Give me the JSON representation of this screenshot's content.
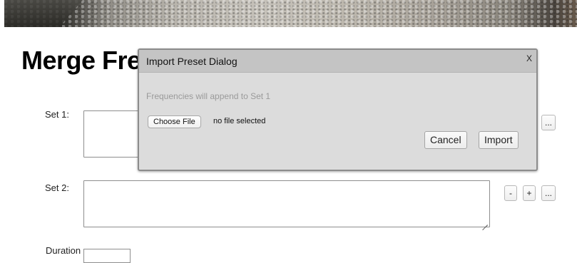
{
  "page": {
    "title": "Merge Frequencies"
  },
  "form": {
    "set1_label": "Set 1:",
    "set2_label": "Set 2:",
    "partial_label": "Duration",
    "buttons": {
      "more": "...",
      "minus": "-",
      "plus": "+"
    }
  },
  "dialog": {
    "title": "Import Preset Dialog",
    "close": "X",
    "note": "Frequencies will append to Set 1",
    "choose_file": "Choose File",
    "file_status": "no file selected",
    "cancel": "Cancel",
    "import": "Import"
  }
}
